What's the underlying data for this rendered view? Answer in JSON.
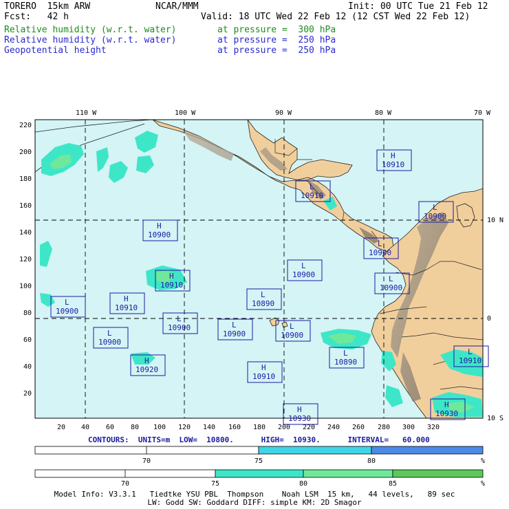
{
  "header": {
    "model": "TORERO  15km ARW",
    "org": "NCAR/MMM",
    "init": "Init: 00 UTC Tue 21 Feb 12",
    "fcst": "Fcst:   42 h",
    "valid": "Valid: 18 UTC Wed 22 Feb 12 (12 CST Wed 22 Feb 12)",
    "fields": [
      {
        "name": "Relative humidity (w.r.t. water)",
        "level": "at pressure =  300 hPa",
        "color": "#1e8c1e"
      },
      {
        "name": "Relative humidity (w.r.t. water)",
        "level": "at pressure =  250 hPa",
        "color": "#2a2ad0"
      },
      {
        "name": "Geopotential height",
        "level": "at pressure =  250 hPa",
        "color": "#2a2ad0"
      }
    ]
  },
  "map": {
    "top_lon_labels": [
      "110 W",
      "100 W",
      "90 W",
      "80 W",
      "70 W"
    ],
    "right_lat_labels": [
      "10 N",
      "0",
      "10 S"
    ],
    "y_ticks": [
      "220",
      "200",
      "180",
      "160",
      "140",
      "120",
      "100",
      "80",
      "60",
      "40",
      "20"
    ],
    "x_ticks": [
      "20",
      "40",
      "60",
      "80",
      "100",
      "120",
      "140",
      "160",
      "180",
      "200",
      "220",
      "240",
      "260",
      "280",
      "300",
      "320"
    ],
    "ocean_color": "#d4f4f6",
    "land_color": "#f1cf9c",
    "labels": [
      {
        "type": "H",
        "value": "10910"
      },
      {
        "type": "L",
        "value": "10910"
      },
      {
        "type": "L",
        "value": "10900"
      },
      {
        "type": "H",
        "value": "10900"
      },
      {
        "type": "L",
        "value": "10900"
      },
      {
        "type": "L",
        "value": "10900"
      },
      {
        "type": "H",
        "value": "10910"
      },
      {
        "type": "L",
        "value": "10900"
      },
      {
        "type": "L",
        "value": "10890"
      },
      {
        "type": "H",
        "value": "10910"
      },
      {
        "type": "L",
        "value": "10900"
      },
      {
        "type": "L",
        "value": "10900"
      },
      {
        "type": "L",
        "value": "10900"
      },
      {
        "type": "L",
        "value": "10900"
      },
      {
        "type": "L",
        "value": "10900"
      },
      {
        "type": "H",
        "value": "10920"
      },
      {
        "type": "L",
        "value": "10890"
      },
      {
        "type": "H",
        "value": "10910"
      },
      {
        "type": "L",
        "value": "10910"
      },
      {
        "type": "H",
        "value": "10930"
      },
      {
        "type": "H",
        "value": "10930"
      }
    ]
  },
  "contours": {
    "text": "CONTOURS:  UNITS=m  LOW=  10800.      HIGH=  10930.      INTERVAL=   60.000"
  },
  "colorbar1": {
    "ticks": [
      "70",
      "75",
      "80"
    ],
    "percent": "%",
    "segments": [
      {
        "from": 65,
        "to": 75,
        "color": "#ffffff"
      },
      {
        "from": 75,
        "to": 80,
        "color": "#3ed6e6"
      },
      {
        "from": 80,
        "to": 85,
        "color": "#4a8ae8"
      }
    ]
  },
  "colorbar2": {
    "ticks": [
      "70",
      "75",
      "80",
      "85"
    ],
    "percent": "%",
    "segments": [
      {
        "from": 65,
        "to": 75,
        "color": "#ffffff"
      },
      {
        "from": 75,
        "to": 80,
        "color": "#3ee6c8"
      },
      {
        "from": 80,
        "to": 85,
        "color": "#6ee89a"
      },
      {
        "from": 85,
        "to": 90,
        "color": "#5cc85c"
      }
    ]
  },
  "footer": {
    "line1": "Model Info: V3.3.1   Tiedtke YSU PBL  Thompson    Noah LSM  15 km,   44 levels,   89 sec",
    "line2": "LW: Godd SW: Goddard DIFF: simple KM: 2D Smagor"
  }
}
